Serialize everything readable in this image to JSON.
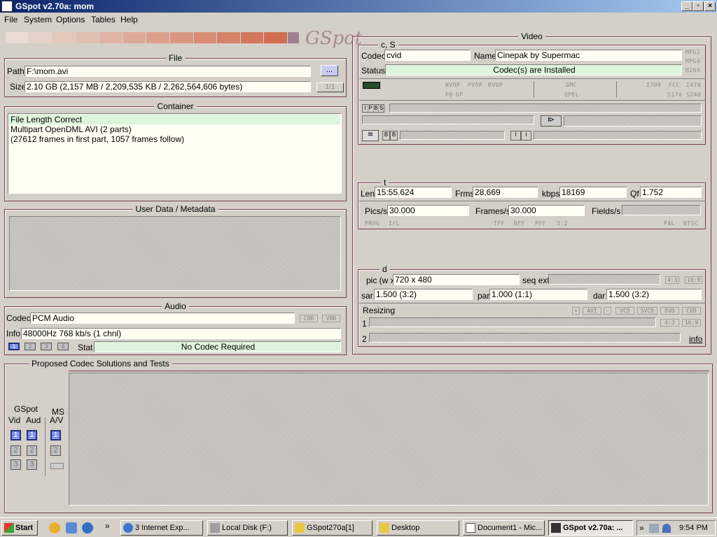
{
  "window": {
    "title": "GSpot v2.70a: mom",
    "min": "_",
    "max": "▫",
    "close": "×"
  },
  "menu": [
    "File",
    "System",
    "Options",
    "Tables",
    "Help"
  ],
  "logo": "GSpot",
  "file": {
    "title": "File",
    "path_label": "Path",
    "path": "F:\\mom.avi",
    "browse": "...",
    "size_label": "Size",
    "size": "2.10 GB (2,157 MB / 2,209,535 KB / 2,262,564,606 bytes)",
    "part": "1/1"
  },
  "container": {
    "title": "Container",
    "lines": [
      "File Length Correct",
      "Multipart OpenDML AVI (2 parts)",
      "(27612 frames in first part, 1057 frames follow)"
    ]
  },
  "userdata": {
    "title": "User Data / Metadata"
  },
  "audio": {
    "title": "Audio",
    "codec_label": "Codec",
    "codec": "PCM Audio",
    "cbr": "CBR",
    "vbr": "VBR",
    "info_label": "Info",
    "info": "48000Hz  768 kb/s (1 chnl)",
    "stat_label": "Stat",
    "stat": "No Codec Required",
    "streams": [
      "1",
      "2",
      "3",
      "4"
    ]
  },
  "video": {
    "title": "Video",
    "cs": "c, S",
    "codec_label": "Codec",
    "codec": "cvid",
    "name_label": "Name",
    "name": "Cinepak by Supermac",
    "status_label": "Status",
    "status": "Codec(s) are Installed",
    "mpeg": [
      "MPG2",
      "MPG4",
      "H264"
    ],
    "flags1": [
      "NVOP",
      "PVOP",
      "BVOP"
    ],
    "flags2": [
      "PB",
      "DF"
    ],
    "gmc": "GMC",
    "qpel": "QPEL",
    "std": [
      "I709",
      "FCC",
      "I470",
      "S170",
      "S240"
    ],
    "ipbs": [
      "I",
      "P",
      "B",
      "S"
    ],
    "bb": [
      "B",
      "B"
    ],
    "ii": [
      "I",
      "I"
    ]
  },
  "timing": {
    "title": "t",
    "len_label": "Len",
    "len": "15:55.624",
    "frms_label": "Frms",
    "frms": "28,669",
    "kbps_label": "kbps",
    "kbps": "18169",
    "qf_label": "Qf",
    "qf": "1.752",
    "pics_label": "Pics/s",
    "pics": "30.000",
    "fps_label": "Frames/s",
    "fps": "30.000",
    "fields_label": "Fields/s",
    "tags": [
      "PROG",
      "I/L",
      "TFF",
      "BFF",
      "PFF",
      "3:2",
      "PAL",
      "NTSC"
    ]
  },
  "dims": {
    "title": "d",
    "pic_label": "pic (w x",
    "pic": "720 x 480",
    "seqext_label": "seq ext",
    "aspect": [
      "4:3",
      "16:9"
    ],
    "sar_label": "sar",
    "sar": "1.500 (3:2)",
    "par_label": "par",
    "par": "1.000 (1:1)",
    "dar_label": "dar",
    "dar": "1.500 (3:2)",
    "resizing_label": "Resizing",
    "rbtn": [
      "+",
      "AVI",
      "-",
      "VCD",
      "SVCD",
      "DVD",
      "CVD"
    ],
    "row1": "1",
    "row2": "2",
    "asp2": [
      "4:3",
      "16:9"
    ],
    "info": "info"
  },
  "proposed": {
    "title": "Proposed Codec Solutions and Tests",
    "gspot": "GSpot",
    "vid": "Vid",
    "aud": "Aud",
    "ms": "MS",
    "av": "A/V",
    "n": [
      "1",
      "2",
      "3"
    ]
  },
  "taskbar": {
    "start": "Start",
    "tasks": [
      "3 Internet Exp...",
      "Local Disk (F:)",
      "GSpot270a[1]",
      "Desktop",
      "Document1 - Mic...",
      "GSpot v2.70a: ..."
    ],
    "time": "9:54 PM",
    "chev": "»"
  }
}
